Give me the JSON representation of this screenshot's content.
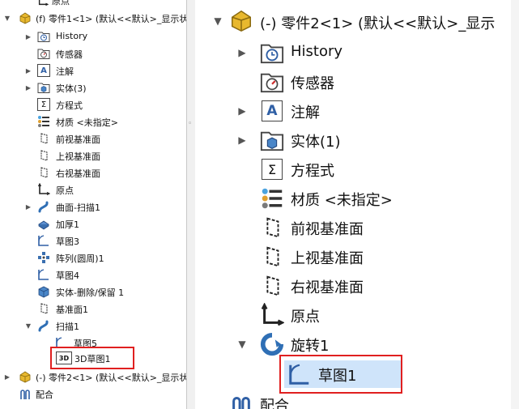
{
  "left_tree": {
    "top_partial": "原点",
    "part1": "(f) 零件1<1> (默认<<默认>_显示状",
    "items": [
      "History",
      "传感器",
      "注解",
      "实体(3)",
      "方程式",
      "材质 <未指定>",
      "前视基准面",
      "上视基准面",
      "右视基准面",
      "原点",
      "曲面-扫描1",
      "加厚1",
      "草图3",
      "阵列(圆周)1",
      "草图4",
      "实体-删除/保留 1",
      "基准面1",
      "扫描1",
      "草图5",
      "3D草图1"
    ],
    "part2": "(-) 零件2<1> (默认<<默认>_显示状",
    "mate": "配合",
    "sketch3d_badge": "3D"
  },
  "right_tree": {
    "part2": "(-) 零件2<1> (默认<<默认>_显示",
    "items": [
      "History",
      "传感器",
      "注解",
      "实体(1)",
      "方程式",
      "材质 <未指定>",
      "前视基准面",
      "上视基准面",
      "右视基准面",
      "原点",
      "旋转1",
      "草图1"
    ],
    "mate": "配合",
    "annotation_icon_letter": "A",
    "equation_icon_symbol": "Σ"
  },
  "colors": {
    "highlight": "#e02020",
    "folder_blue": "#3a6fb0",
    "part_yellow": "#e8b82e"
  }
}
